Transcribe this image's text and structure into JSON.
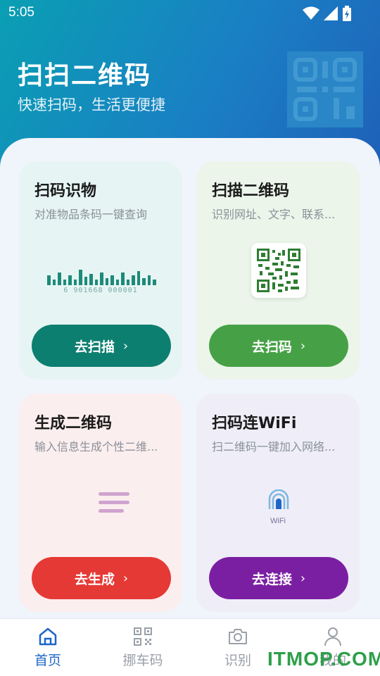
{
  "status": {
    "time": "5:05"
  },
  "hero": {
    "title": "扫扫二维码",
    "subtitle": "快速扫码，生活更便捷"
  },
  "cards": [
    {
      "title": "扫码识物",
      "desc": "对准物品条码一键查询",
      "button": "去扫描",
      "barcode_number": "6 901668 000001",
      "color": "#0d7f70"
    },
    {
      "title": "扫描二维码",
      "desc": "识别网址、文字、联系...",
      "button": "去扫码",
      "color": "#46a146"
    },
    {
      "title": "生成二维码",
      "desc": "输入信息生成个性二维...",
      "button": "去生成",
      "color": "#e53935"
    },
    {
      "title": "扫码连WiFi",
      "desc": "扫二维码一键加入网络...",
      "button": "去连接",
      "wifi_label": "WiFi",
      "color": "#7b1fa2"
    }
  ],
  "nav": [
    {
      "label": "首页",
      "icon": "home-icon",
      "active": true
    },
    {
      "label": "挪车码",
      "icon": "qr-icon",
      "active": false
    },
    {
      "label": "识别",
      "icon": "camera-icon",
      "active": false
    },
    {
      "label": "我的",
      "icon": "user-icon",
      "active": false
    }
  ],
  "watermark": "ITMOP.COM",
  "colors": {
    "accent": "#1e66c7",
    "header_start": "#0a9fb3",
    "header_end": "#1f5fb8"
  }
}
